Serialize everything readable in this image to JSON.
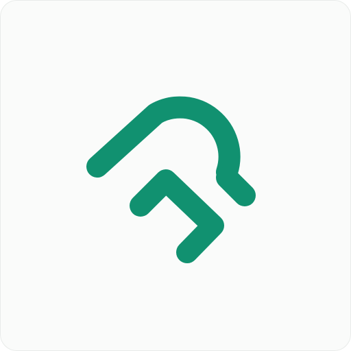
{
  "icon": {
    "name": "app-logo-icon",
    "background_color": "#fafbfa",
    "border_color": "#e8ebe9",
    "mark_color": "#119170"
  }
}
